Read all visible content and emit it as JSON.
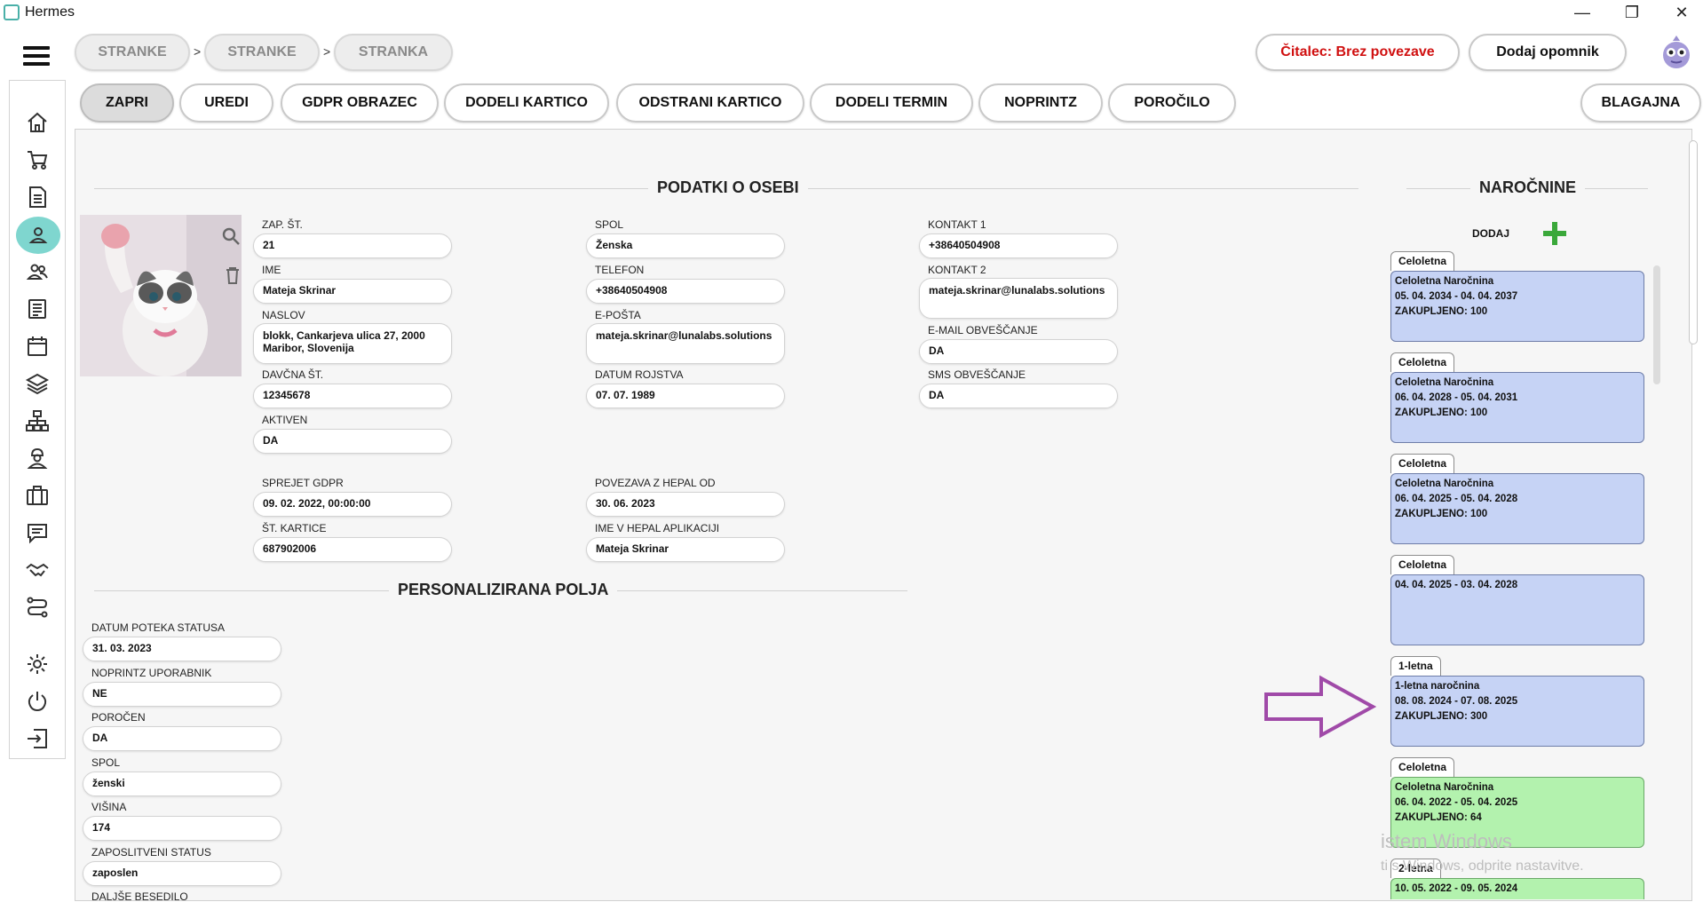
{
  "window": {
    "title": "Hermes",
    "minimize": "—",
    "restore": "❐",
    "close": "✕"
  },
  "breadcrumbs": [
    "STRANKE",
    "STRANKE",
    "STRANKA"
  ],
  "breadcrumb_sep": ">",
  "top_right": {
    "reader_status": "Čitalec: Brez povezave",
    "reminder": "Dodaj opomnik"
  },
  "actions": [
    "ZAPRI",
    "UREDI",
    "GDPR OBRAZEC",
    "DODELI KARTICO",
    "ODSTRANI KARTICO",
    "DODELI TERMIN",
    "NOPRINTZ",
    "POROČILO"
  ],
  "blagajna": "BLAGAJNA",
  "person": {
    "section_title": "PODATKI O OSEBI",
    "fields": {
      "zap_st": {
        "label": "ZAP. ŠT.",
        "value": "21"
      },
      "ime": {
        "label": "IME",
        "value": "Mateja Skrinar"
      },
      "naslov": {
        "label": "NASLOV",
        "value": "blokk, Cankarjeva ulica 27, 2000 Maribor, Slovenija"
      },
      "davcna": {
        "label": "DAVČNA ŠT.",
        "value": "12345678"
      },
      "aktiven": {
        "label": "AKTIVEN",
        "value": "DA"
      },
      "spol": {
        "label": "SPOL",
        "value": "Ženska"
      },
      "telefon": {
        "label": "TELEFON",
        "value": "+38640504908"
      },
      "eposta": {
        "label": "E-POŠTA",
        "value": "mateja.skrinar@lunalabs.solutions"
      },
      "rojstvo": {
        "label": "DATUM ROJSTVA",
        "value": "07. 07. 1989"
      },
      "kontakt1": {
        "label": "KONTAKT 1",
        "value": "+38640504908"
      },
      "kontakt2": {
        "label": "KONTAKT 2",
        "value": "mateja.skrinar@lunalabs.solutions"
      },
      "email_obv": {
        "label": "E-MAIL OBVEŠČANJE",
        "value": "DA"
      },
      "sms_obv": {
        "label": "SMS OBVEŠČANJE",
        "value": "DA"
      },
      "gdpr": {
        "label": "SPREJET GDPR",
        "value": "09. 02. 2022, 00:00:00"
      },
      "kartica": {
        "label": "ŠT. KARTICE",
        "value": "687902006"
      },
      "hepal_od": {
        "label": "POVEZAVA Z HEPAL OD",
        "value": "30. 06. 2023"
      },
      "hepal_ime": {
        "label": "IME V HEPAL APLIKACIJI",
        "value": "Mateja Skrinar"
      }
    }
  },
  "custom": {
    "section_title": "PERSONALIZIRANA POLJA",
    "fields": {
      "status_date": {
        "label": "DATUM POTEKA STATUSA",
        "value": "31. 03. 2023"
      },
      "noprintz": {
        "label": "NOPRINTZ UPORABNIK",
        "value": "NE"
      },
      "porocen": {
        "label": "POROČEN",
        "value": "DA"
      },
      "spol": {
        "label": "SPOL",
        "value": "ženski"
      },
      "visina": {
        "label": "VIŠINA",
        "value": "174"
      },
      "zaposlitev": {
        "label": "ZAPOSLITVENI STATUS",
        "value": "zaposlen"
      },
      "besedilo": {
        "label": "DALJŠE BESEDILO",
        "value": ""
      }
    }
  },
  "subscriptions": {
    "section_title": "NAROČNINE",
    "add_label": "DODAJ",
    "items": [
      {
        "tab": "Celoletna",
        "lines": [
          "Celoletna Naročnina",
          "05. 04. 2034 - 04. 04. 2037",
          "ZAKUPLJENO: 100"
        ],
        "color": "#c6d3f5"
      },
      {
        "tab": "Celoletna",
        "lines": [
          "Celoletna Naročnina",
          "06. 04. 2028 - 05. 04. 2031",
          "ZAKUPLJENO: 100"
        ],
        "color": "#c6d3f5"
      },
      {
        "tab": "Celoletna",
        "lines": [
          "Celoletna Naročnina",
          "06. 04. 2025 - 05. 04. 2028",
          "ZAKUPLJENO: 100"
        ],
        "color": "#c6d3f5"
      },
      {
        "tab": "Celoletna",
        "lines": [
          "04. 04. 2025 - 03. 04. 2028",
          "",
          ""
        ],
        "color": "#c6d3f5"
      },
      {
        "tab": "1-letna",
        "lines": [
          "1-letna naročnina",
          "08. 08. 2024 - 07. 08. 2025",
          "ZAKUPLJENO: 300"
        ],
        "color": "#c6d3f5"
      },
      {
        "tab": "Celoletna",
        "lines": [
          "Celoletna Naročnina",
          "06. 04. 2022 - 05. 04. 2025",
          "ZAKUPLJENO: 64"
        ],
        "color": "#b3f2ae"
      },
      {
        "tab": "2-letna",
        "lines": [
          "10. 05. 2022 - 09. 05. 2024",
          "",
          ""
        ],
        "color": "#b3f2ae"
      }
    ]
  },
  "watermark": {
    "line1": "istem Windows",
    "line2": "ti s   Windows, odprite nastavitve."
  },
  "colors": {
    "accent_teal": "#7fd6cf",
    "reader_red": "#d01010",
    "add_green": "#3aa83a",
    "arrow_purple": "#a04aa8"
  },
  "icons": [
    "home-icon",
    "cart-icon",
    "document-icon",
    "user-icon",
    "users-icon",
    "list-icon",
    "calendar-icon",
    "layers-icon",
    "sitemap-icon",
    "worker-icon",
    "briefcase-icon",
    "chat-icon",
    "handshake-icon",
    "route-icon",
    "gear-icon",
    "power-icon",
    "logout-icon"
  ]
}
